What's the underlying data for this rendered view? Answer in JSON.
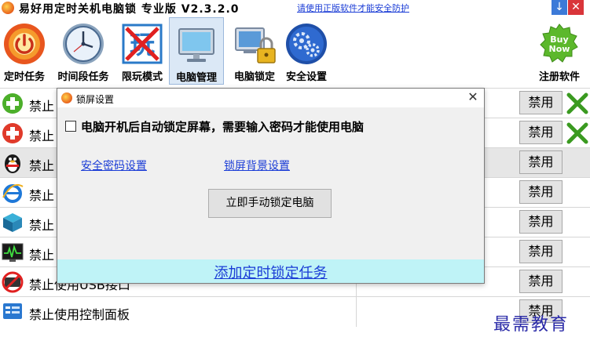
{
  "title_bar": {
    "title": "易好用定时关机电脑锁 专业版 V2.3.2.0",
    "notice_link": "请使用正版软件才能安全防护",
    "minimize_glyph": "↓",
    "close_glyph": "✕"
  },
  "toolbar": {
    "items": [
      {
        "label": "定时任务",
        "icon": "power-icon"
      },
      {
        "label": "时间段任务",
        "icon": "clock-icon"
      },
      {
        "label": "限玩模式",
        "icon": "play-limit-icon"
      },
      {
        "label": "电脑管理",
        "icon": "monitor-icon"
      },
      {
        "label": "电脑锁定",
        "icon": "computer-lock-icon"
      },
      {
        "label": "安全设置",
        "icon": "gears-icon"
      },
      {
        "label": "注册软件",
        "icon": "buy-now-icon"
      }
    ],
    "buy_text": "Buy Now",
    "selected": "电脑管理"
  },
  "list": {
    "rows": [
      {
        "text": "禁止",
        "icon": "green-plus-icon",
        "button": "禁用"
      },
      {
        "text": "禁止",
        "icon": "red-plus-icon",
        "button": "禁用"
      },
      {
        "text": "禁止",
        "icon": "qq-penguin-icon",
        "button": "禁用"
      },
      {
        "text": "禁止",
        "icon": "ie-browser-icon",
        "button": "禁用"
      },
      {
        "text": "禁止",
        "icon": "game-box-icon",
        "button": "禁用"
      },
      {
        "text": "禁止",
        "icon": "monitor-pulse-icon",
        "button": "禁用"
      },
      {
        "text": "禁止使用USB接口",
        "icon": "usb-forbidden-icon",
        "button": "禁用"
      },
      {
        "text": "禁止使用控制面板",
        "icon": "control-panel-icon",
        "button": "禁用"
      }
    ]
  },
  "dialog": {
    "title": "锁屏设置",
    "close_glyph": "✕",
    "auto_lock_label": "电脑开机后自动锁定屏幕，需要输入密码才能使用电脑",
    "auto_lock_checked": false,
    "password_link": "安全密码设置",
    "background_link": "锁屏背景设置",
    "lock_now_button": "立即手动锁定电脑",
    "add_task_link": "添加定时锁定任务"
  },
  "watermark": "最需教育",
  "colors": {
    "link": "#1a3cd6",
    "footer_bg": "#bff3f7",
    "selected_tool_bg": "#dbe8f6",
    "close_red": "#d9353a"
  }
}
